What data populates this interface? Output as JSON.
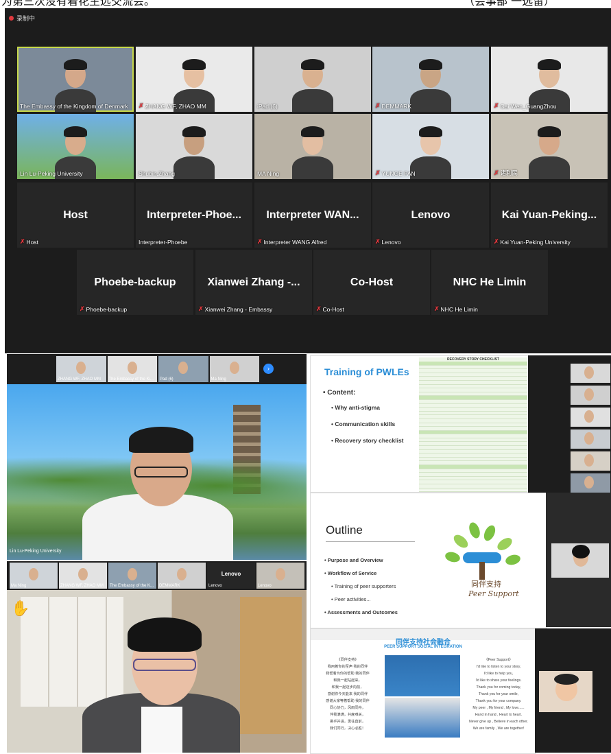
{
  "caption": {
    "left_text": "为第三次没有着花主远交流会。",
    "right_text": "（会事部 一选留）"
  },
  "recording": {
    "label": "录制中"
  },
  "gallery": {
    "video_tiles": [
      {
        "label": "The Embassy of the Kingdom of Denmark",
        "muted": false,
        "active": true
      },
      {
        "label": "ZHANG WF, ZHAO MM",
        "muted": true,
        "active": false
      },
      {
        "label": "iPad (6)",
        "muted": false,
        "active": false
      },
      {
        "label": "DEMMARK",
        "muted": true,
        "active": false
      },
      {
        "label": "Cai Wen_GuangZhou",
        "muted": true,
        "active": false
      },
      {
        "label": "Lin Lu-Peking University",
        "muted": false,
        "active": false
      },
      {
        "label": "Shubin,Zhang",
        "muted": false,
        "active": false
      },
      {
        "label": "MA Ning",
        "muted": false,
        "active": false
      },
      {
        "label": "YUNGE FAN",
        "muted": true,
        "active": false
      },
      {
        "label": "诸利民",
        "muted": true,
        "active": false
      }
    ],
    "name_tiles_row1": [
      {
        "name": "Host",
        "label": "Host",
        "muted": true
      },
      {
        "name": "Interpreter-Phoe...",
        "label": "Interpreter-Phoebe",
        "muted": false
      },
      {
        "name": "Interpreter  WAN...",
        "label": "Interpreter WANG Alfred",
        "muted": true
      },
      {
        "name": "Lenovo",
        "label": "Lenovo",
        "muted": true
      },
      {
        "name": "Kai  Yuan-Peking...",
        "label": "Kai Yuan-Peking University",
        "muted": true
      }
    ],
    "name_tiles_row2": [
      {
        "name": "Phoebe-backup",
        "label": "Phoebe-backup",
        "muted": true
      },
      {
        "name": "Xianwei Zhang -...",
        "label": "Xianwei Zhang - Embassy",
        "muted": true
      },
      {
        "name": "Co-Host",
        "label": "Co-Host",
        "muted": true
      },
      {
        "name": "NHC He Limin",
        "label": "NHC He Limin",
        "muted": true
      }
    ]
  },
  "bottom_left": {
    "top_strip": [
      "ZHANG WF, ZHAO MM",
      "The Embassy of the Ki...",
      "Pad (6)",
      "Ma Ning"
    ],
    "speaker_label": "Lin Lu-Peking University",
    "lower_strip": [
      "Ma Ning",
      "ZHANG WF, ZHAO MM",
      "The Embassy of the K...",
      "DEMMARK",
      "Lenovo",
      "Lenovo"
    ],
    "lower_strip_name_tile": "Lenovo"
  },
  "slide1": {
    "title": "Training of PWLEs",
    "content_label": "• Content:",
    "bullets": [
      "• Why anti-stigma",
      "• Communication skills",
      "• Recovery story checklist"
    ],
    "checklist_title": "RECOVERY STORY CHECKLIST"
  },
  "slide2": {
    "title": "Outline",
    "bullets": [
      "• Purpose and Overview",
      "• Workflow of Service"
    ],
    "sub_bullets": [
      "• Training of peer supporters",
      "• Peer activities..."
    ],
    "last_bullet": "• Assessments and Outcomes",
    "logo_cn": "同伴支持",
    "logo_en": "Peer Support"
  },
  "slide3": {
    "title_cn": "同伴支持社会融合",
    "title_en": "PEER SUPPORT SOCIAL INTEGRATION",
    "poem_title": "《同伴支持》",
    "poem_lines": [
      "我用着你的至声 我的同伴",
      "我帮着为你的帮助 我的同伴",
      "和我一起站起来，",
      "和我一起迈步向前，",
      "感谢你今天能来 我的同伴",
      "感谢大家等着帮助 我的同伴",
      "同心协力，风雨同舟，",
      "伴我满满，共度难关，",
      "携手并进，勇往直前，",
      "我们同行，决心必胜！"
    ],
    "en_title": "《Peer Support》",
    "en_lines": [
      "I'd like to listen to your story,",
      "I'd like to help you,",
      "I'd like to share your feelings.",
      "Thank you for coming today,",
      "Thank you for your smile,",
      "Thank you for your company.",
      "My peer , My friend , My love......",
      "Hand in hand , Heart to heart.",
      "Never give up , Believe in each other.",
      "We are family , We are together!"
    ]
  },
  "colors": {
    "zoom_bg": "#1c1c1c",
    "tile_bg": "#262626",
    "active_border": "#c8d94a",
    "mute_red": "#e0393e",
    "slide_blue": "#2c8ed6",
    "checklist_green": "#c9e5b5"
  }
}
